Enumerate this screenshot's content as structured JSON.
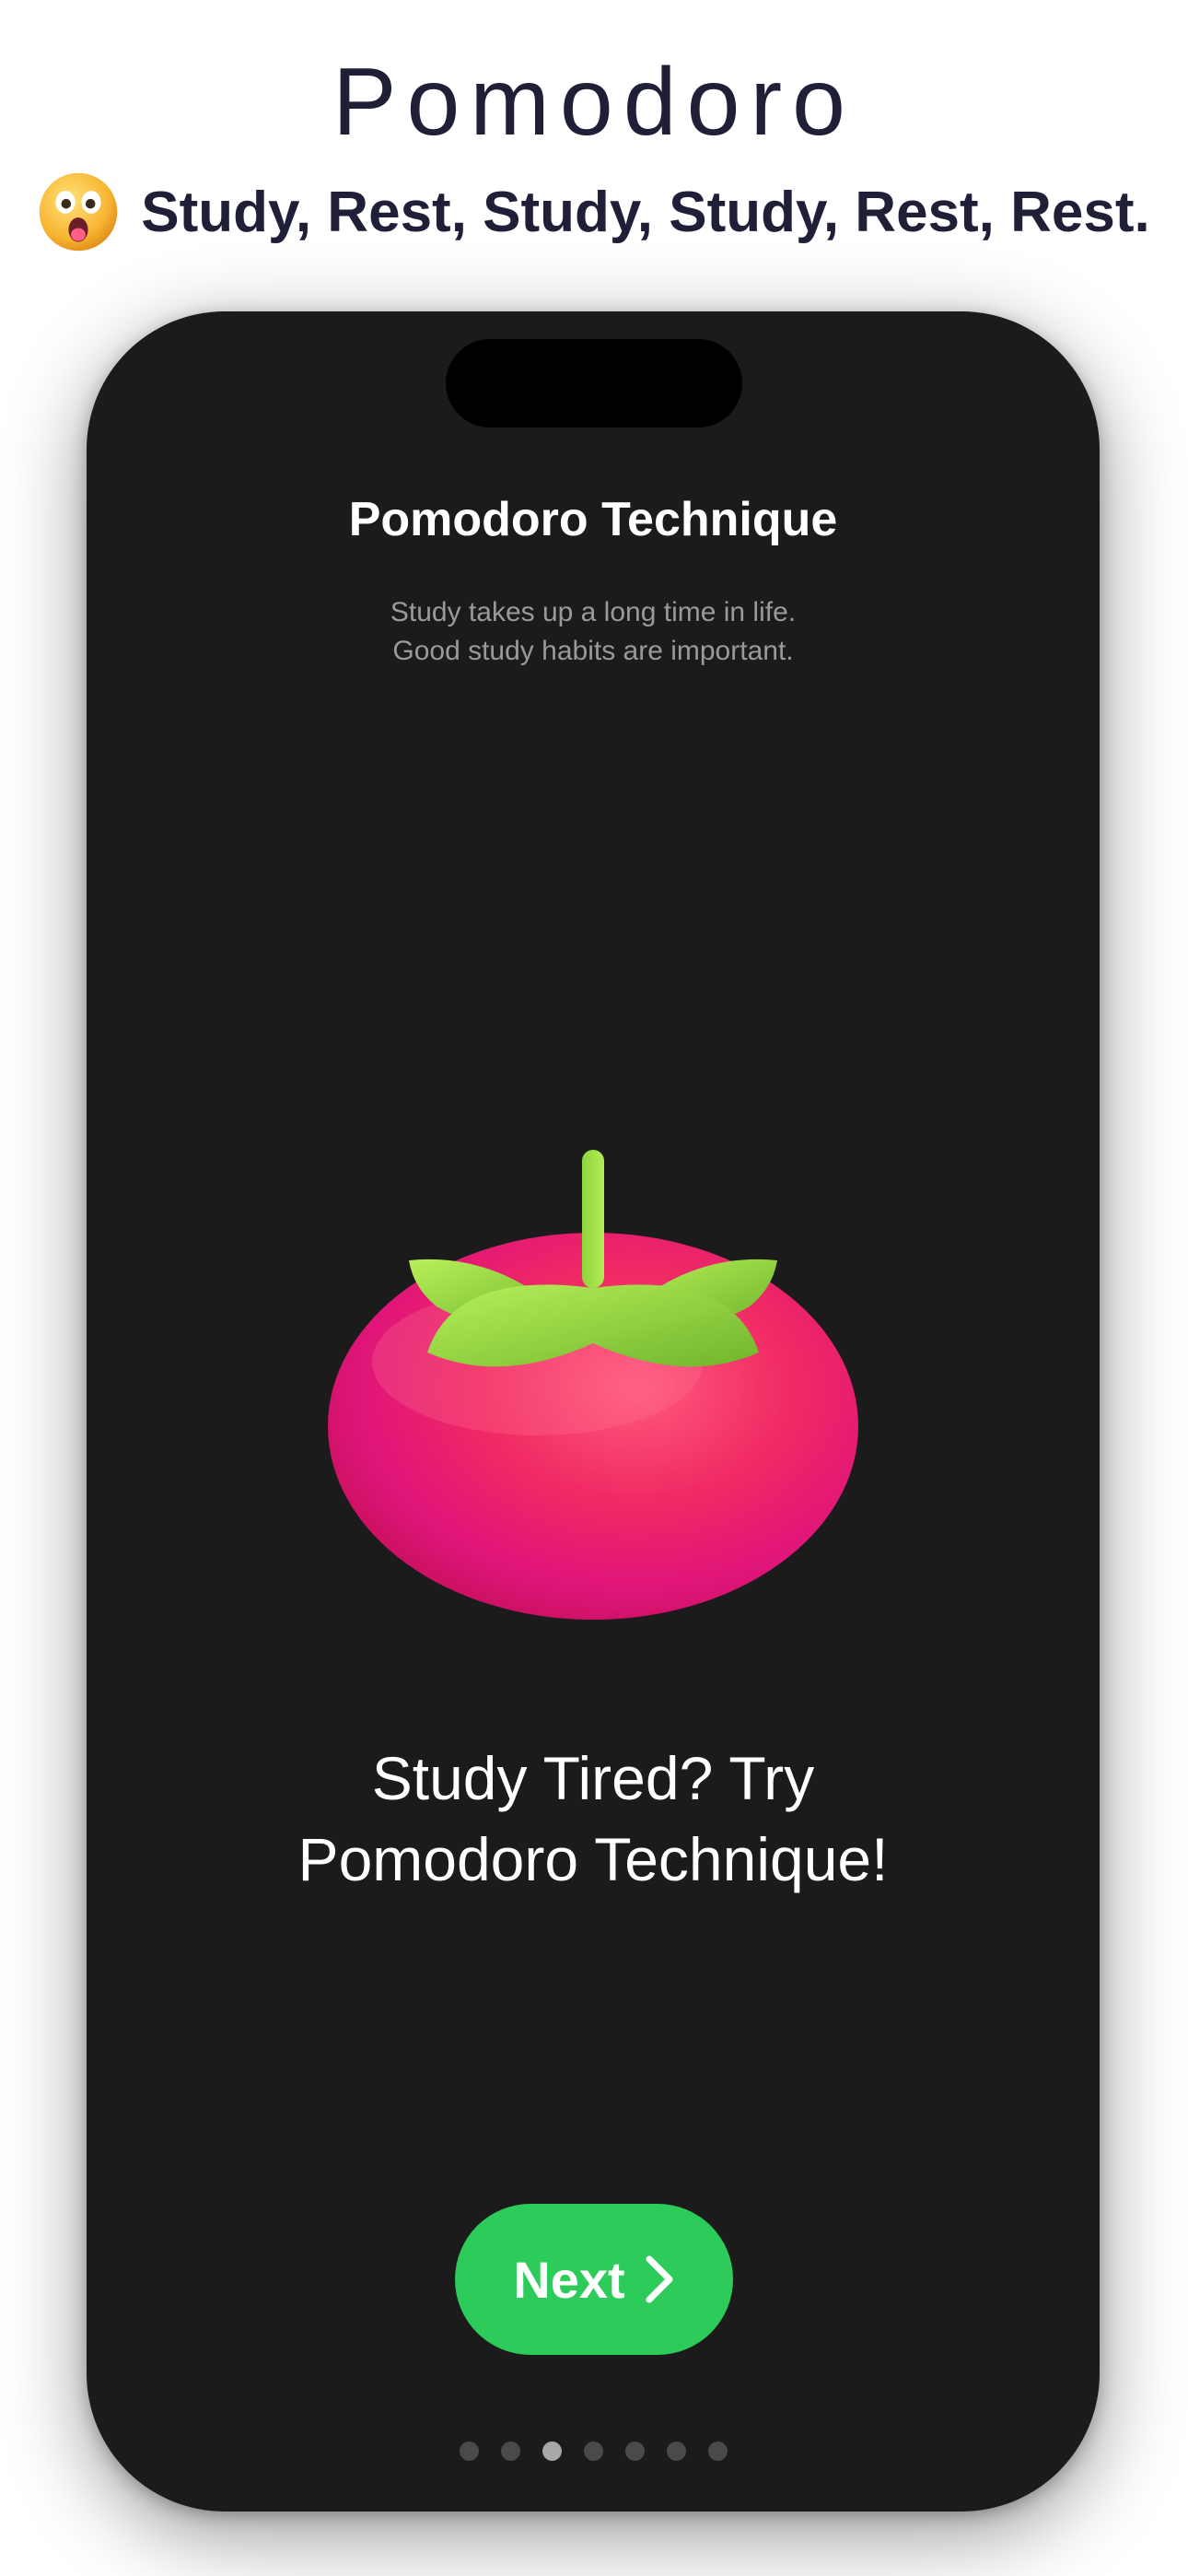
{
  "hero": {
    "title": "Pomodoro",
    "emoji_icon": "astonished-face-icon",
    "tagline": "Study, Rest, Study, Study, Rest, Rest."
  },
  "screen": {
    "title": "Pomodoro Technique",
    "subtitle_lines": [
      "Study takes up a long time in life.",
      "Good study habits are important."
    ],
    "illustration_icon": "tomato-icon",
    "headline_lines": [
      "Study Tired? Try",
      "Pomodoro Technique!"
    ],
    "next_button": {
      "label": "Next",
      "icon": "chevron-right-icon",
      "color": "#2DCC5A"
    },
    "pagination": {
      "total": 7,
      "active": 3
    }
  },
  "colors": {
    "heading": "#1F2038",
    "screen_background": "#1B1B1B",
    "tomato": "#F0326A",
    "leaves": "#8FD43B"
  }
}
